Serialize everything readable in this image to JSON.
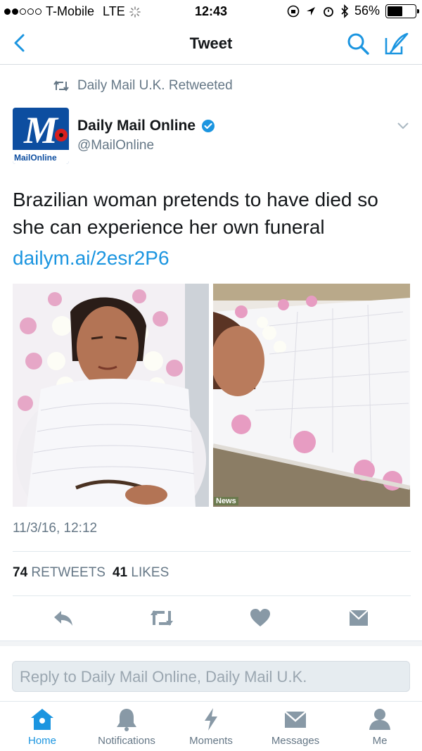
{
  "status_bar": {
    "carrier": "T-Mobile",
    "network": "LTE",
    "time": "12:43",
    "battery_percent": "56%",
    "battery_level": 0.56,
    "signal_bars_filled": 2,
    "signal_bars_total": 5
  },
  "nav": {
    "title": "Tweet"
  },
  "tweet": {
    "retweeted_by": "Daily Mail U.K. Retweeted",
    "author_name": "Daily Mail Online",
    "author_handle": "@MailOnline",
    "avatar_text": "MailOnline",
    "text": "Brazilian woman pretends to have died so she can experience her own funeral",
    "link": "dailym.ai/2esr2P6",
    "media_tag": "News",
    "date": "11/3/16, 12:12",
    "retweets_count": "74",
    "retweets_label": "RETWEETS",
    "likes_count": "41",
    "likes_label": "LIKES"
  },
  "reply": {
    "placeholder": "Reply to Daily Mail Online, Daily Mail U.K."
  },
  "tabs": [
    {
      "label": "Home",
      "icon": "home-icon",
      "active": true
    },
    {
      "label": "Notifications",
      "icon": "bell-icon",
      "active": false
    },
    {
      "label": "Moments",
      "icon": "lightning-icon",
      "active": false
    },
    {
      "label": "Messages",
      "icon": "envelope-icon",
      "active": false
    },
    {
      "label": "Me",
      "icon": "person-icon",
      "active": false
    }
  ],
  "colors": {
    "accent": "#1b95e0",
    "secondary_text": "#657786",
    "action_icons": "#8899a6",
    "brand_blue": "#0d4ea0"
  }
}
